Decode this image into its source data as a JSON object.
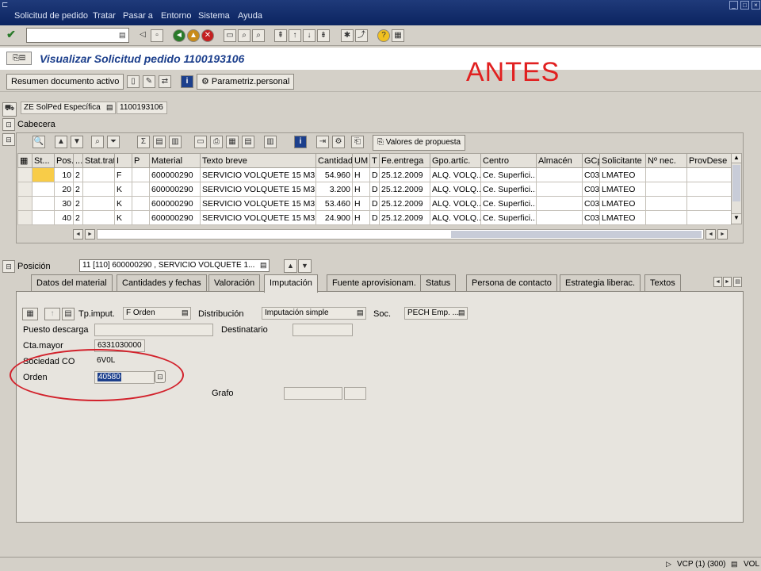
{
  "menubar": {
    "items": [
      "Solicitud de pedido",
      "Tratar",
      "Pasar a",
      "Entorno",
      "Sistema",
      "Ayuda"
    ]
  },
  "command_field": {
    "value": ""
  },
  "title": {
    "text": "Visualizar Solicitud pedido 1100193106",
    "annotation": "ANTES"
  },
  "app_toolbar": {
    "summary_button": "Resumen documento activo",
    "personal_settings_button": "Parametriz.personal"
  },
  "header": {
    "doc_type_value": "ZE SolPed Específica",
    "doc_number": "1100193106",
    "cabecera_label": "Cabecera"
  },
  "grid": {
    "proposal_button": "Valores de propuesta",
    "columns": [
      "St...",
      "Pos...",
      "...",
      "Stat.trat.",
      "I",
      "P",
      "Material",
      "Texto breve",
      "Cantidad",
      "UM",
      "T",
      "Fe.entrega",
      "Gpo.artíc.",
      "Centro",
      "Almacén",
      "GCp",
      "Solicitante",
      "Nº nec.",
      "ProvDese"
    ],
    "rows": [
      {
        "pos": "10",
        "c": "2",
        "i": "F",
        "material": "600000290",
        "text": "SERVICIO VOLQUETE 15 M3",
        "qty": "54.960",
        "um": "H",
        "t": "D",
        "date": "25.12.2009",
        "group": "ALQ. VOLQ...",
        "plant": "Ce. Superfici...",
        "gcp": "C03",
        "req": "LMATEO"
      },
      {
        "pos": "20",
        "c": "2",
        "i": "K",
        "material": "600000290",
        "text": "SERVICIO VOLQUETE 15 M3",
        "qty": "3.200",
        "um": "H",
        "t": "D",
        "date": "25.12.2009",
        "group": "ALQ. VOLQ...",
        "plant": "Ce. Superfici...",
        "gcp": "C03",
        "req": "LMATEO"
      },
      {
        "pos": "30",
        "c": "2",
        "i": "K",
        "material": "600000290",
        "text": "SERVICIO VOLQUETE 15 M3",
        "qty": "53.460",
        "um": "H",
        "t": "D",
        "date": "25.12.2009",
        "group": "ALQ. VOLQ...",
        "plant": "Ce. Superfici...",
        "gcp": "C03",
        "req": "LMATEO"
      },
      {
        "pos": "40",
        "c": "2",
        "i": "K",
        "material": "600000290",
        "text": "SERVICIO VOLQUETE 15 M3",
        "qty": "24.900",
        "um": "H",
        "t": "D",
        "date": "25.12.2009",
        "group": "ALQ. VOLQ...",
        "plant": "Ce. Superfici...",
        "gcp": "C03",
        "req": "LMATEO"
      }
    ]
  },
  "position": {
    "label": "Posición",
    "value": "11 [110] 600000290 , SERVICIO VOLQUETE 1..."
  },
  "tabs": [
    "Datos del material",
    "Cantidades y fechas",
    "Valoración",
    "Imputación",
    "Fuente aprovisionam.",
    "Status",
    "Persona de contacto",
    "Estrategia liberac.",
    "Textos"
  ],
  "active_tab": "Imputación",
  "imputacion": {
    "tp_imput_label": "Tp.imput.",
    "tp_imput_value": "F Orden",
    "distribucion_label": "Distribución",
    "distribucion_value": "Imputación simple",
    "soc_label": "Soc.",
    "soc_value": "PECH Emp. ...",
    "puesto_label": "Puesto descarga",
    "puesto_value": "",
    "destinatario_label": "Destinatario",
    "destinatario_value": "",
    "cta_mayor_label": "Cta.mayor",
    "cta_mayor_value": "6331030000",
    "sociedad_co_label": "Sociedad CO",
    "sociedad_co_value": "6V0L",
    "orden_label": "Orden",
    "orden_value": "40580",
    "grafo_label": "Grafo",
    "grafo_value": ""
  },
  "statusbar": {
    "system": "VCP (1) (300)",
    "server": "VOL"
  }
}
